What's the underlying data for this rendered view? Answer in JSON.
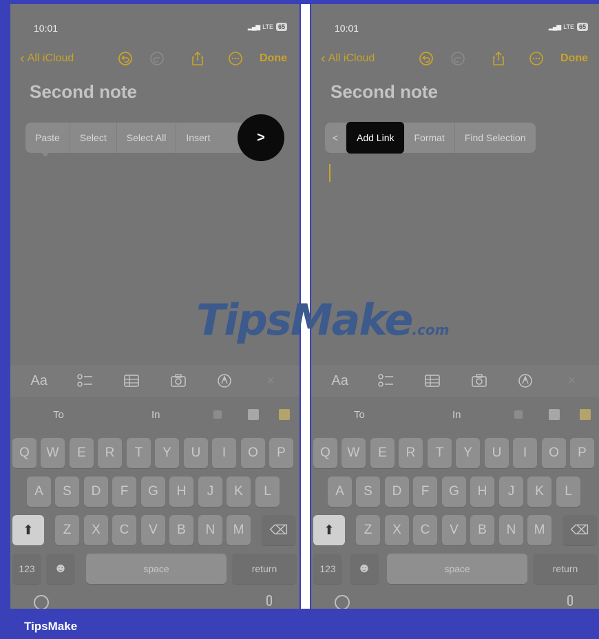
{
  "status": {
    "time": "10:01",
    "network": "LTE",
    "battery": "65"
  },
  "nav": {
    "back_label": "All iCloud",
    "done_label": "Done"
  },
  "note": {
    "title": "Second note"
  },
  "left_menu": {
    "items": [
      "Paste",
      "Select",
      "Select All",
      "Insert"
    ],
    "more_glyph": ">"
  },
  "right_menu": {
    "back_glyph": "<",
    "items": [
      "Add Link",
      "Format",
      "Find Selection"
    ]
  },
  "format_bar": {
    "text_style_label": "Aa",
    "close_glyph": "×"
  },
  "suggestions": [
    "To",
    "In"
  ],
  "keyboard": {
    "row1": [
      "Q",
      "W",
      "E",
      "R",
      "T",
      "Y",
      "U",
      "I",
      "O",
      "P"
    ],
    "row2": [
      "A",
      "S",
      "D",
      "F",
      "G",
      "H",
      "J",
      "K",
      "L"
    ],
    "row3": [
      "Z",
      "X",
      "C",
      "V",
      "B",
      "N",
      "M"
    ],
    "numbers_label": "123",
    "space_label": "space",
    "return_label": "return"
  },
  "watermark": {
    "main": "TipsMake",
    "suffix": ".com"
  },
  "footer": {
    "brand": "TipsMake"
  },
  "colors": {
    "accent": "#c9a42a",
    "frame": "#3a41b8",
    "panel": "#757575"
  }
}
